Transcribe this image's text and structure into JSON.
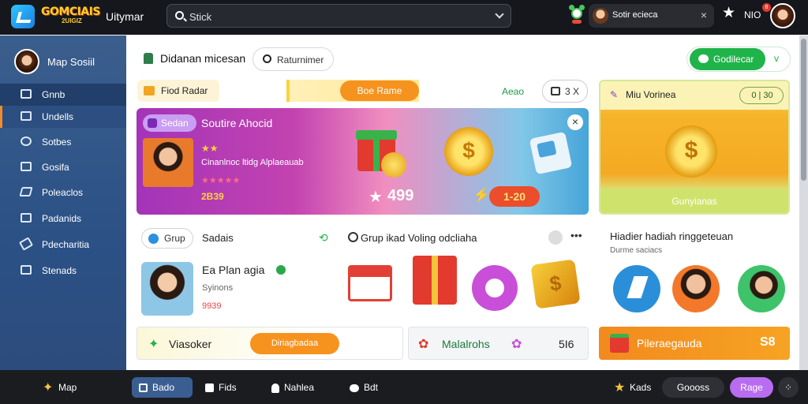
{
  "header": {
    "brand_main": "GOMCIAIS",
    "brand_sub": "2UIGIZ",
    "app_title": "Uitymar",
    "search_placeholder": "Stick",
    "chip_label": "Sotir ecieca",
    "nav_name": "NIO",
    "notification_count": "8"
  },
  "sidebar": {
    "profile_name": "Map Sosiil",
    "items": [
      {
        "label": "Gnnb"
      },
      {
        "label": "Undells"
      },
      {
        "label": "Sotbes"
      },
      {
        "label": "Gosifa"
      },
      {
        "label": "Poleaclos"
      },
      {
        "label": "Padanids"
      },
      {
        "label": "Pdecharitia"
      },
      {
        "label": "Stenads"
      }
    ]
  },
  "toolbar": {
    "title": "Didanan micesan",
    "search_chip": "Raturnimer",
    "primary_button": "Godilecar",
    "chevron": "v"
  },
  "promo_row": {
    "label": "Fiod Radar",
    "button": "Boe Rame",
    "status": "Aeao",
    "counter": "3 X",
    "side_title": "Miu Vorinea",
    "side_counter": "0 | 30"
  },
  "hero": {
    "tag": "Sedan",
    "title": "Soutire Ahocid",
    "subtitle": "Cinanlnoc ltidg Alplaeauab",
    "points": "2B39",
    "score": "499",
    "price": "1-20",
    "side_button": "Gunyianas"
  },
  "row2": {
    "group_tag": "Grup",
    "section_label": "Sadais",
    "group_title": "Grup ikad Voling odcliaha",
    "profile_name": "Ea Plan agia",
    "profile_sub": "Syinons",
    "profile_stat": "9939",
    "right_title": "Hiadier hadiah ringgeteuan",
    "right_sub": "Durme saciacs"
  },
  "bottom_cards": {
    "card1_label": "Viasoker",
    "card1_button": "Diriagbadaa",
    "card2_label": "Malalrohs",
    "card2_value": "5I6",
    "card3_label": "Pileraegauda",
    "card3_value": "S8"
  },
  "bottom_nav": {
    "items": [
      {
        "label": "Map"
      },
      {
        "label": "Bado"
      },
      {
        "label": "Fids"
      },
      {
        "label": "Nahlea"
      },
      {
        "label": "Bdt"
      }
    ],
    "right_star": "Kads",
    "right_pill1": "Goooss",
    "right_pill2": "Rage"
  },
  "colors": {
    "accent_orange": "#f6a323",
    "accent_green": "#1fb44a",
    "accent_purple": "#b86cf0",
    "sidebar_blue": "#2b5186"
  }
}
